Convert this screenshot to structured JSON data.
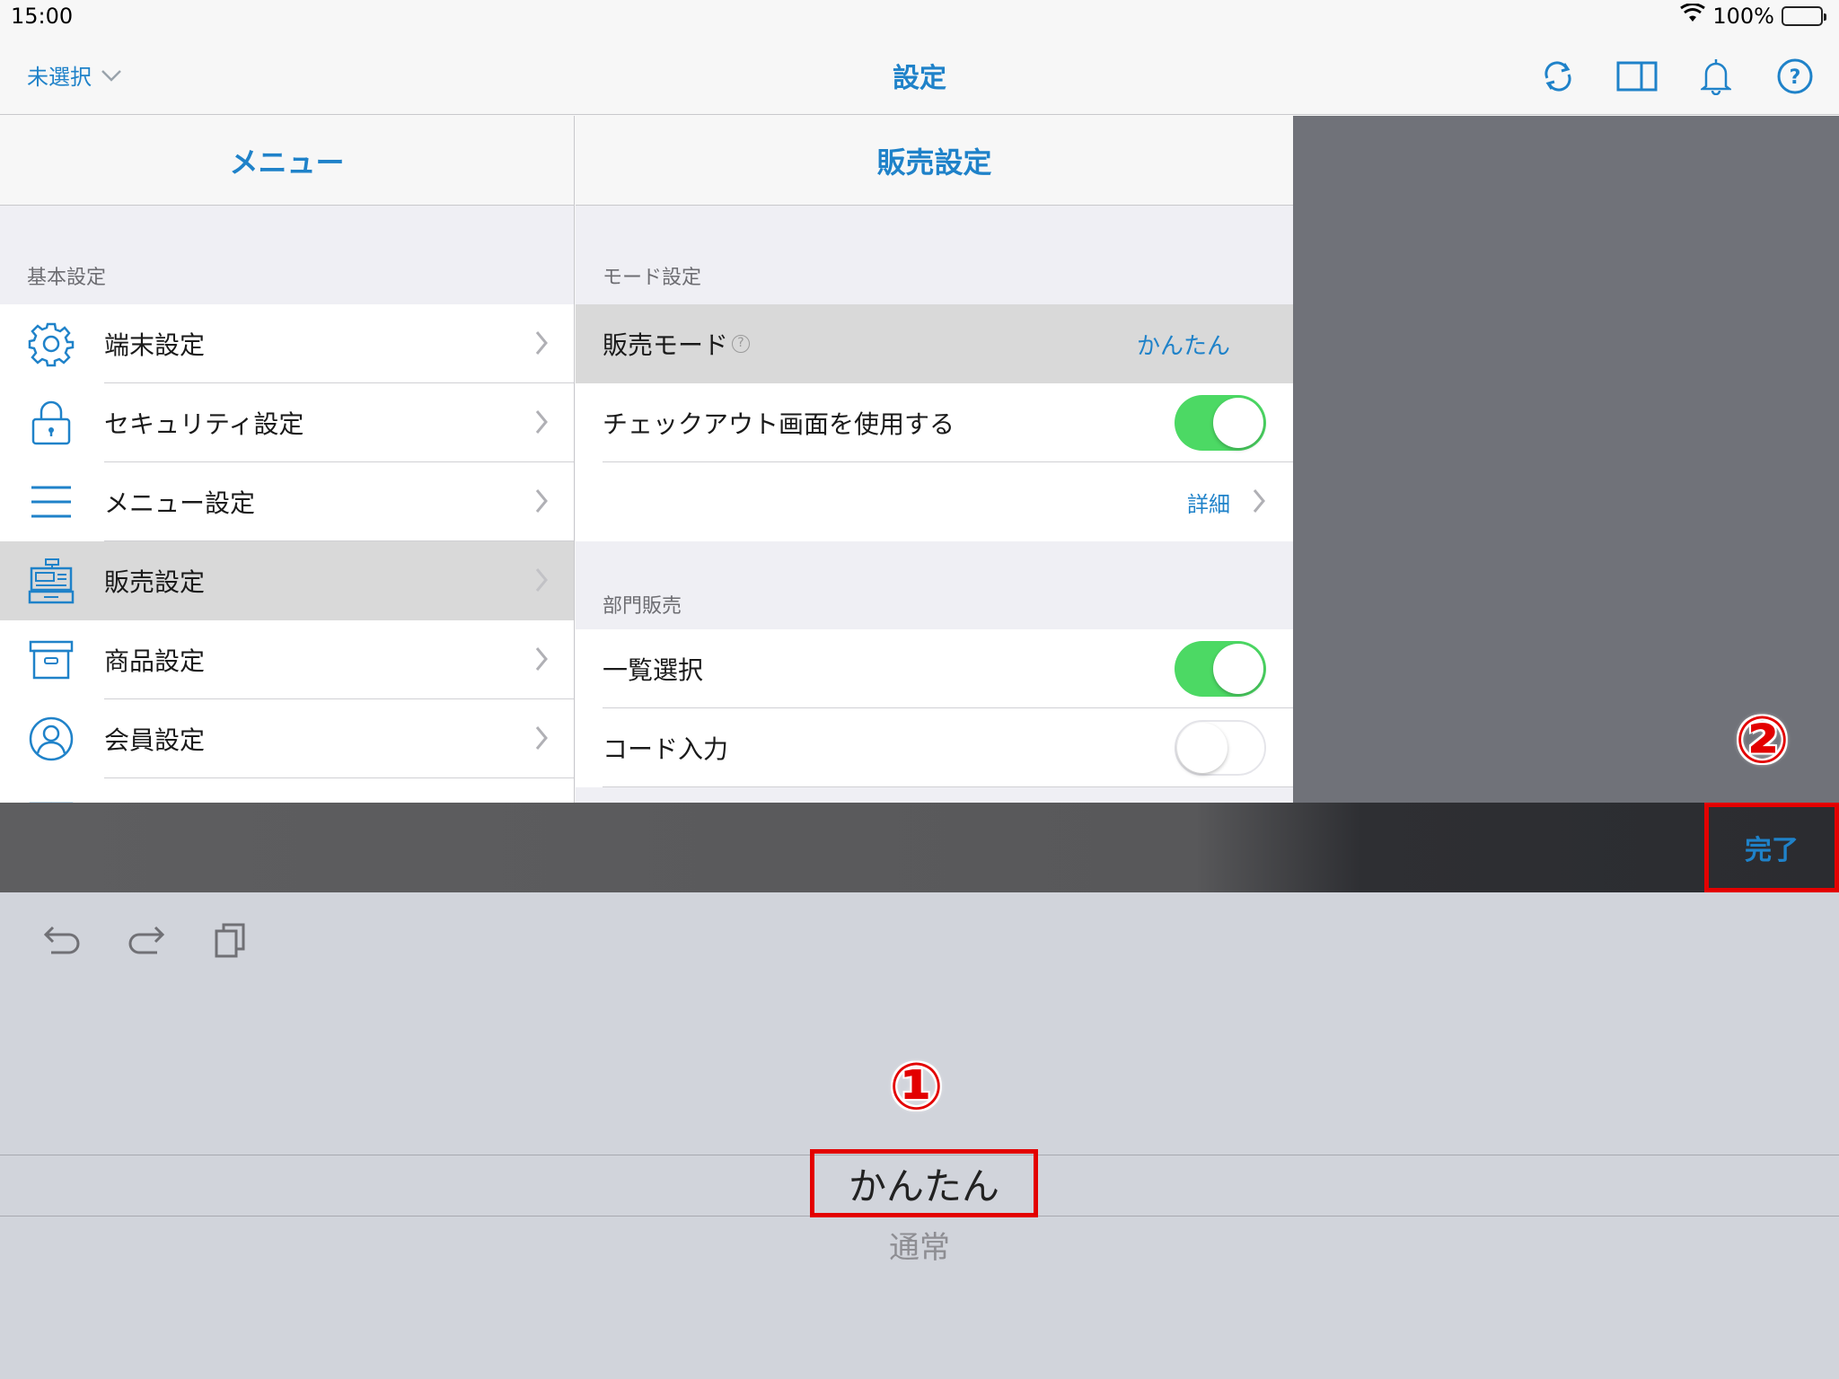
{
  "status_bar": {
    "time": "15:00",
    "battery": "100%"
  },
  "nav": {
    "left_label": "未選択",
    "title": "設定"
  },
  "menu": {
    "header": "メニュー",
    "section": "基本設定",
    "items": [
      {
        "label": "端末設定",
        "icon": "gear-icon"
      },
      {
        "label": "セキュリティ設定",
        "icon": "lock-icon"
      },
      {
        "label": "メニュー設定",
        "icon": "list-icon"
      },
      {
        "label": "販売設定",
        "icon": "register-icon",
        "selected": true
      },
      {
        "label": "商品設定",
        "icon": "box-icon"
      },
      {
        "label": "会員設定",
        "icon": "person-icon"
      }
    ]
  },
  "detail": {
    "header": "販売設定",
    "mode_section": "モード設定",
    "sales_mode": {
      "label": "販売モード",
      "help": "?",
      "value": "かんたん"
    },
    "checkout": {
      "label": "チェックアウト画面を使用する",
      "on": true
    },
    "details_link": "詳細",
    "dept_section": "部門販売",
    "list_select": {
      "label": "一覧選択",
      "on": true
    },
    "code_input": {
      "label": "コード入力",
      "on": false
    }
  },
  "picker": {
    "done_label": "完了",
    "selected": "かんたん",
    "other": "通常",
    "marker_1": "①",
    "marker_2": "②"
  },
  "colors": {
    "accent": "#1f82c9",
    "toggle_on": "#4cd964",
    "highlight": "#e30000"
  }
}
